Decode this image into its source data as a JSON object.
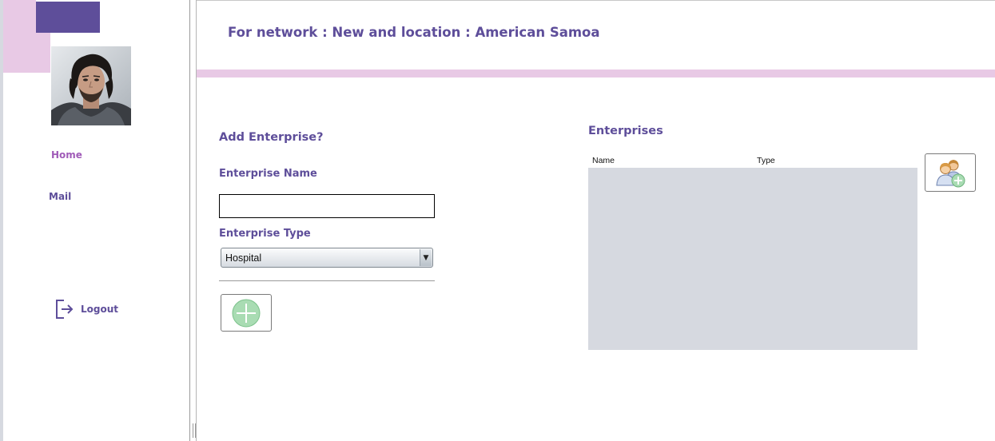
{
  "sidebar": {
    "nav": {
      "home_label": "Home",
      "mail_label": "Mail",
      "logout_label": "Logout"
    },
    "avatar_icon": "user-photo",
    "logout_icon": "logout-icon"
  },
  "header": {
    "title": "For network : New and location : American Samoa"
  },
  "form": {
    "title": "Add Enterprise?",
    "name_label": "Enterprise Name",
    "name_value": "",
    "type_label": "Enterprise Type",
    "type_value": "Hospital",
    "add_button_icon": "plus-circle-icon"
  },
  "enterprises": {
    "title": "Enterprises",
    "columns": [
      "Name",
      "Type"
    ],
    "rows": [],
    "add_user_button_icon": "add-user-icon"
  },
  "colors": {
    "accent": "#5e4e9a",
    "accent_pink": "#e8c9e5",
    "home_active": "#a05bb8",
    "table_bg": "#d6d9e0"
  }
}
